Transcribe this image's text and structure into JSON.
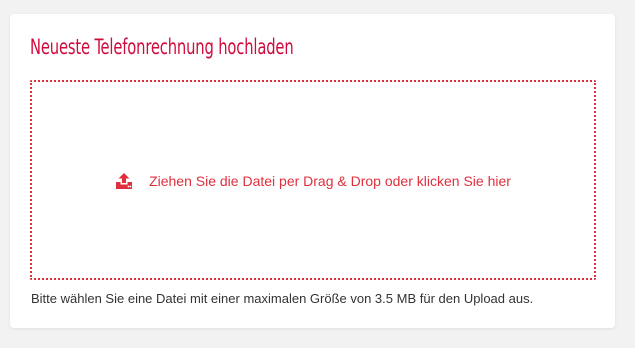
{
  "upload_card": {
    "title": "Neueste Telefonrechnung hochladen",
    "dropzone_text": "Ziehen Sie die Datei per Drag & Drop oder klicken Sie hier",
    "upload_icon": "upload-icon",
    "hint": "Bitte wählen Sie eine Datei mit einer maximalen Größe von 3.5 MB für den Upload aus."
  },
  "colors": {
    "accent": "#d10a3c",
    "dropzone_border": "#e0303d",
    "background": "#f2f2f2",
    "card": "#ffffff",
    "text": "#333333"
  }
}
